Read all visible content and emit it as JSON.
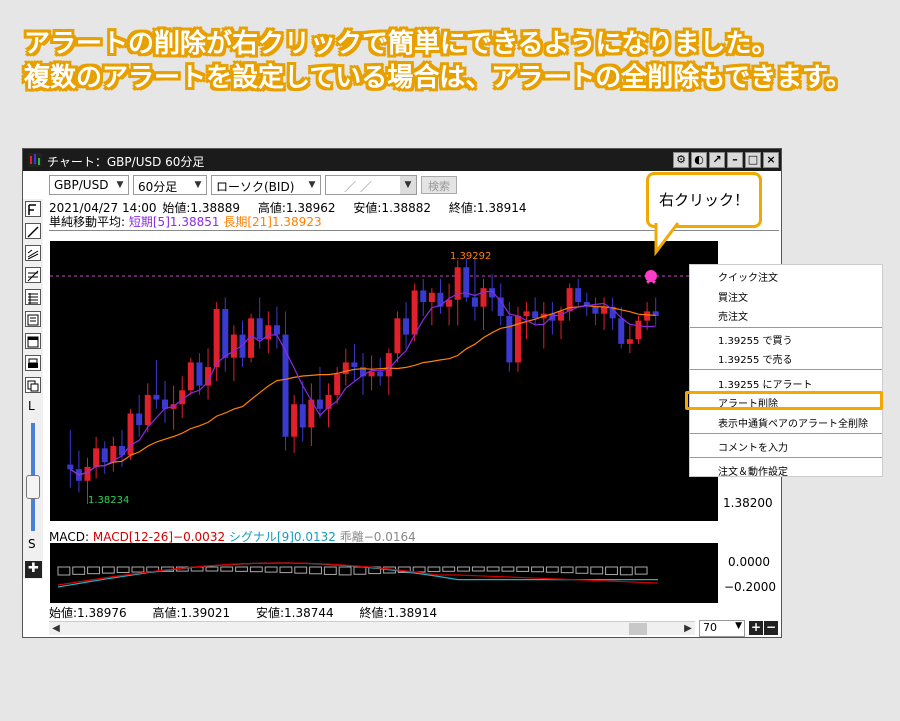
{
  "headline": {
    "line1": "アラートの削除が右クリックで簡単にできるようになりました。",
    "line2": "複数のアラートを設定している場合は、アラートの全削除もできます。"
  },
  "window": {
    "title": "チャート：GBP/USD 60分足",
    "title_buttons": [
      "gear-icon",
      "palette-icon",
      "popout-icon",
      "minimize-icon",
      "maximize-icon",
      "close-icon"
    ]
  },
  "toolbar": {
    "pair": "GBP/USD",
    "timeframe": "60分足",
    "chart_type": "ローソク(BID)",
    "date": "／ ／",
    "search_label": "検索"
  },
  "ohlc_top": {
    "datetime": "2021/04/27 14:00",
    "open": "始値:1.38889",
    "high": "高値:1.38962",
    "low": "安値:1.38882",
    "close": "終値:1.38914"
  },
  "ma": {
    "label": "単純移動平均:",
    "short": "短期[5]1.38851",
    "long": "長期[21]1.38923"
  },
  "price_chart": {
    "high_label": "1.39292",
    "low_label": "1.38234",
    "axis_label": "1.38200"
  },
  "macd": {
    "label": "MACD:",
    "macd": "MACD[12-26]−0.0032",
    "signal": "シグナル[9]0.0132",
    "divergence": "乖離−0.0164",
    "axis_zero": "0.0000",
    "axis_low": "−0.2000"
  },
  "ohlc_bottom": {
    "open": "始値:1.38976",
    "high": "高値:1.39021",
    "low": "安値:1.38744",
    "close": "終値:1.38914"
  },
  "left_tools": {
    "slider_top": "L",
    "slider_bottom": "S"
  },
  "zoom": {
    "value": "70"
  },
  "context_menu": {
    "items": [
      "クイック注文",
      "買注文",
      "売注文",
      "1.39255 で買う",
      "1.39255 で売る",
      "1.39255 にアラート",
      "アラート削除",
      "表示中通貨ペアのアラート全削除",
      "コメントを入力",
      "注文＆動作設定"
    ]
  },
  "callout": {
    "text": "右クリック！"
  },
  "colors": {
    "accent": "#f2a800",
    "bull": "#e0202a",
    "bear": "#3a3ad0",
    "ma_short": "#8b2be2",
    "ma_long": "#ff7f00"
  },
  "chart_data": {
    "type": "candlestick",
    "candles": [
      [
        1.384,
        1.3855,
        1.383,
        1.3838
      ],
      [
        1.3838,
        1.3846,
        1.3828,
        1.3833
      ],
      [
        1.3833,
        1.3843,
        1.3823,
        1.3839
      ],
      [
        1.3839,
        1.3852,
        1.3834,
        1.3847
      ],
      [
        1.3847,
        1.385,
        1.3836,
        1.3841
      ],
      [
        1.3841,
        1.3852,
        1.3837,
        1.3848
      ],
      [
        1.3848,
        1.3855,
        1.3839,
        1.3844
      ],
      [
        1.3844,
        1.3864,
        1.3842,
        1.3862
      ],
      [
        1.3862,
        1.387,
        1.3852,
        1.3857
      ],
      [
        1.3857,
        1.3875,
        1.3854,
        1.387
      ],
      [
        1.387,
        1.3885,
        1.3864,
        1.3868
      ],
      [
        1.3868,
        1.3876,
        1.3858,
        1.3864
      ],
      [
        1.3864,
        1.3874,
        1.3855,
        1.3866
      ],
      [
        1.3866,
        1.3878,
        1.386,
        1.3872
      ],
      [
        1.3872,
        1.3886,
        1.387,
        1.3884
      ],
      [
        1.3884,
        1.3888,
        1.387,
        1.3874
      ],
      [
        1.3874,
        1.389,
        1.3868,
        1.3882
      ],
      [
        1.3882,
        1.391,
        1.3876,
        1.3907
      ],
      [
        1.3907,
        1.3912,
        1.388,
        1.3886
      ],
      [
        1.3886,
        1.39,
        1.3876,
        1.3896
      ],
      [
        1.3896,
        1.3902,
        1.3882,
        1.3886
      ],
      [
        1.3886,
        1.3905,
        1.3884,
        1.3903
      ],
      [
        1.3903,
        1.3912,
        1.389,
        1.3894
      ],
      [
        1.3894,
        1.3906,
        1.3888,
        1.39
      ],
      [
        1.39,
        1.3908,
        1.389,
        1.3896
      ],
      [
        1.3896,
        1.3906,
        1.3846,
        1.3852
      ],
      [
        1.3852,
        1.387,
        1.3845,
        1.3866
      ],
      [
        1.3866,
        1.3876,
        1.385,
        1.3856
      ],
      [
        1.3856,
        1.3875,
        1.3848,
        1.3868
      ],
      [
        1.3868,
        1.3882,
        1.386,
        1.3864
      ],
      [
        1.3864,
        1.3875,
        1.3856,
        1.387
      ],
      [
        1.387,
        1.3882,
        1.3866,
        1.3879
      ],
      [
        1.3879,
        1.389,
        1.3874,
        1.3884
      ],
      [
        1.3884,
        1.3892,
        1.3876,
        1.3882
      ],
      [
        1.3882,
        1.3888,
        1.387,
        1.3878
      ],
      [
        1.3878,
        1.3887,
        1.3872,
        1.388
      ],
      [
        1.388,
        1.3886,
        1.3874,
        1.3878
      ],
      [
        1.3878,
        1.389,
        1.387,
        1.3888
      ],
      [
        1.3888,
        1.3906,
        1.3884,
        1.3903
      ],
      [
        1.3903,
        1.391,
        1.389,
        1.3896
      ],
      [
        1.3896,
        1.3918,
        1.3893,
        1.3915
      ],
      [
        1.3915,
        1.392,
        1.3904,
        1.391
      ],
      [
        1.391,
        1.3916,
        1.39,
        1.3914
      ],
      [
        1.3914,
        1.392,
        1.3905,
        1.3908
      ],
      [
        1.3908,
        1.3918,
        1.39,
        1.3911
      ],
      [
        1.3911,
        1.3928,
        1.39,
        1.3925
      ],
      [
        1.3925,
        1.3929,
        1.391,
        1.3912
      ],
      [
        1.3912,
        1.3929,
        1.3902,
        1.3908
      ],
      [
        1.3908,
        1.392,
        1.3898,
        1.3916
      ],
      [
        1.3916,
        1.3922,
        1.3906,
        1.3912
      ],
      [
        1.3912,
        1.3918,
        1.39,
        1.3904
      ],
      [
        1.3904,
        1.391,
        1.388,
        1.3884
      ],
      [
        1.3884,
        1.3908,
        1.388,
        1.3904
      ],
      [
        1.3904,
        1.391,
        1.3894,
        1.3906
      ],
      [
        1.3906,
        1.3912,
        1.39,
        1.3903
      ],
      [
        1.3903,
        1.391,
        1.389,
        1.3905
      ],
      [
        1.3905,
        1.391,
        1.3896,
        1.3902
      ],
      [
        1.3902,
        1.3908,
        1.3894,
        1.3906
      ],
      [
        1.3906,
        1.3918,
        1.3902,
        1.3916
      ],
      [
        1.3916,
        1.392,
        1.3908,
        1.391
      ],
      [
        1.391,
        1.3914,
        1.3904,
        1.3908
      ],
      [
        1.3908,
        1.3912,
        1.39,
        1.3905
      ],
      [
        1.3905,
        1.3912,
        1.3898,
        1.3908
      ],
      [
        1.3908,
        1.3912,
        1.3898,
        1.3903
      ],
      [
        1.3903,
        1.3908,
        1.389,
        1.3892
      ],
      [
        1.3892,
        1.39,
        1.3888,
        1.3894
      ],
      [
        1.3894,
        1.3904,
        1.3892,
        1.3902
      ],
      [
        1.3902,
        1.391,
        1.3898,
        1.3906
      ],
      [
        1.3906,
        1.3912,
        1.39,
        1.3904
      ]
    ]
  }
}
